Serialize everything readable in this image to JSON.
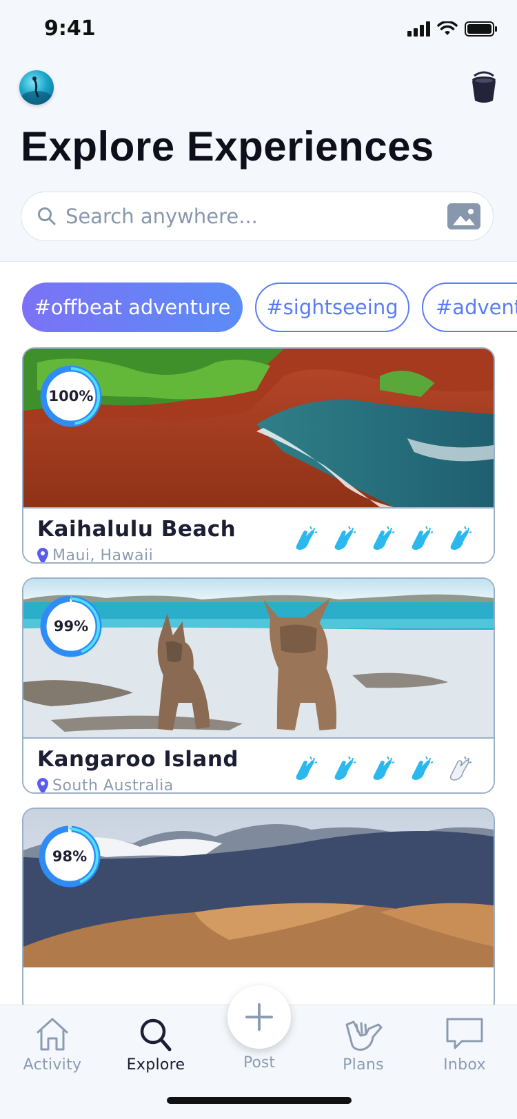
{
  "status_bar": {
    "time": "9:41"
  },
  "header": {
    "title": "Explore Experiences"
  },
  "search": {
    "placeholder": "Search anywhere..."
  },
  "tags": [
    {
      "label": "#offbeat adventure",
      "active": true
    },
    {
      "label": "#sightseeing",
      "active": false
    },
    {
      "label": "#adventure",
      "active": false
    }
  ],
  "cards": [
    {
      "name": "Kaihalulu Beach",
      "location": "Maui, Hawaii",
      "match": "100%",
      "match_value": 1.0,
      "claps": 5,
      "claps_max": 5
    },
    {
      "name": "Kangaroo Island",
      "location": "South Australia",
      "match": "99%",
      "match_value": 0.99,
      "claps": 4,
      "claps_max": 5
    },
    {
      "name": "",
      "location": "",
      "match": "98%",
      "match_value": 0.98,
      "claps": 0,
      "claps_max": 5
    }
  ],
  "tabbar": {
    "activity": "Activity",
    "explore": "Explore",
    "post": "Post",
    "plans": "Plans",
    "inbox": "Inbox"
  },
  "colors": {
    "accent": "#5a7cf6",
    "clap_active": "#2bb8ef",
    "clap_inactive": "#b8c6d8",
    "muted": "#8c9bb1"
  }
}
